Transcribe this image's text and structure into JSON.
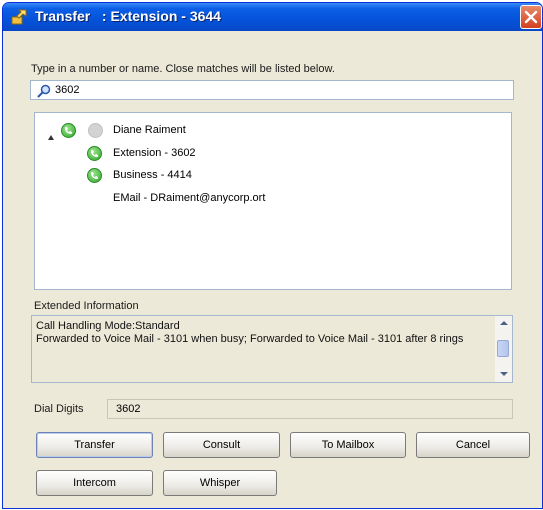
{
  "window": {
    "title": "Transfer   : Extension - 3644"
  },
  "search": {
    "instruction": "Type in a number or name.  Close matches will be listed below.",
    "value": "3602"
  },
  "results": {
    "contact_name": "Diane Raiment",
    "items": [
      {
        "label": "Extension - 3602",
        "icon": "phone-icon"
      },
      {
        "label": "Business - 4414",
        "icon": "phone-icon"
      },
      {
        "label": "EMail - DRaiment@anycorp.ort",
        "icon": "none"
      }
    ]
  },
  "extended_info": {
    "label": "Extended Information",
    "line1": "Call Handling Mode:Standard",
    "line2": "Forwarded to Voice Mail - 3101 when busy; Forwarded to Voice Mail - 3101 after 8 rings"
  },
  "dial": {
    "label": "Dial Digits",
    "value": "3602"
  },
  "buttons": {
    "transfer": "Transfer",
    "consult": "Consult",
    "to_mailbox": "To Mailbox",
    "cancel": "Cancel",
    "intercom": "Intercom",
    "whisper": "Whisper"
  },
  "colors": {
    "titlebar": "#0450d6",
    "close": "#d2401f",
    "phone_icon": "#2ea82a"
  }
}
